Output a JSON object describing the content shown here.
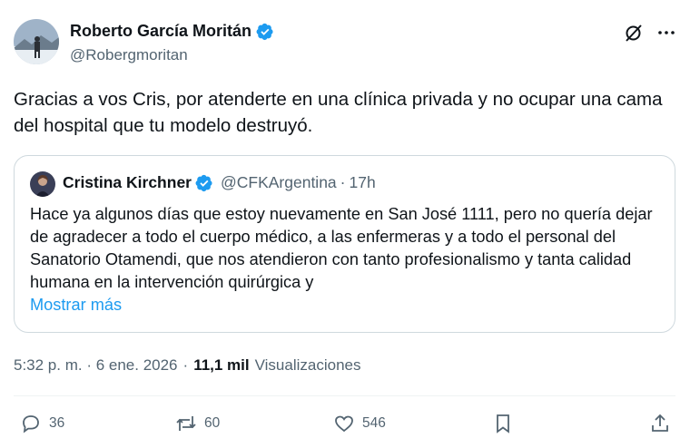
{
  "author": {
    "name": "Roberto García Moritán",
    "handle": "@Robergmoritan"
  },
  "tweet": {
    "text": "Gracias a vos Cris, por atenderte en una clínica privada y no ocupar una cama del hospital que tu modelo destruyó."
  },
  "quote": {
    "name": "Cristina Kirchner",
    "handle": "@CFKArgentina",
    "separator": "·",
    "time": "17h",
    "text": "Hace ya algunos días que estoy nuevamente en San José 1111, pero no quería dejar de agradecer a todo el cuerpo médico, a las enfermeras y a todo el personal del Sanatorio Otamendi, que nos atendieron con tanto profesionalismo y tanta calidad humana en la intervención quirúrgica y",
    "show_more": "Mostrar más"
  },
  "meta": {
    "timestamp": "5:32 p. m. · 6 ene. 2026",
    "separator": "·",
    "views_count": "11,1 mil",
    "views_label": "Visualizaciones"
  },
  "actions": {
    "replies": "36",
    "reposts": "60",
    "likes": "546"
  },
  "colors": {
    "accent": "#1d9bf0",
    "text": "#0f1419",
    "secondary": "#536471",
    "border": "#cfd9de"
  },
  "icons": [
    "verified-badge-icon",
    "grok-icon",
    "more-icon",
    "reply-icon",
    "repost-icon",
    "like-icon",
    "bookmark-icon",
    "share-icon"
  ]
}
